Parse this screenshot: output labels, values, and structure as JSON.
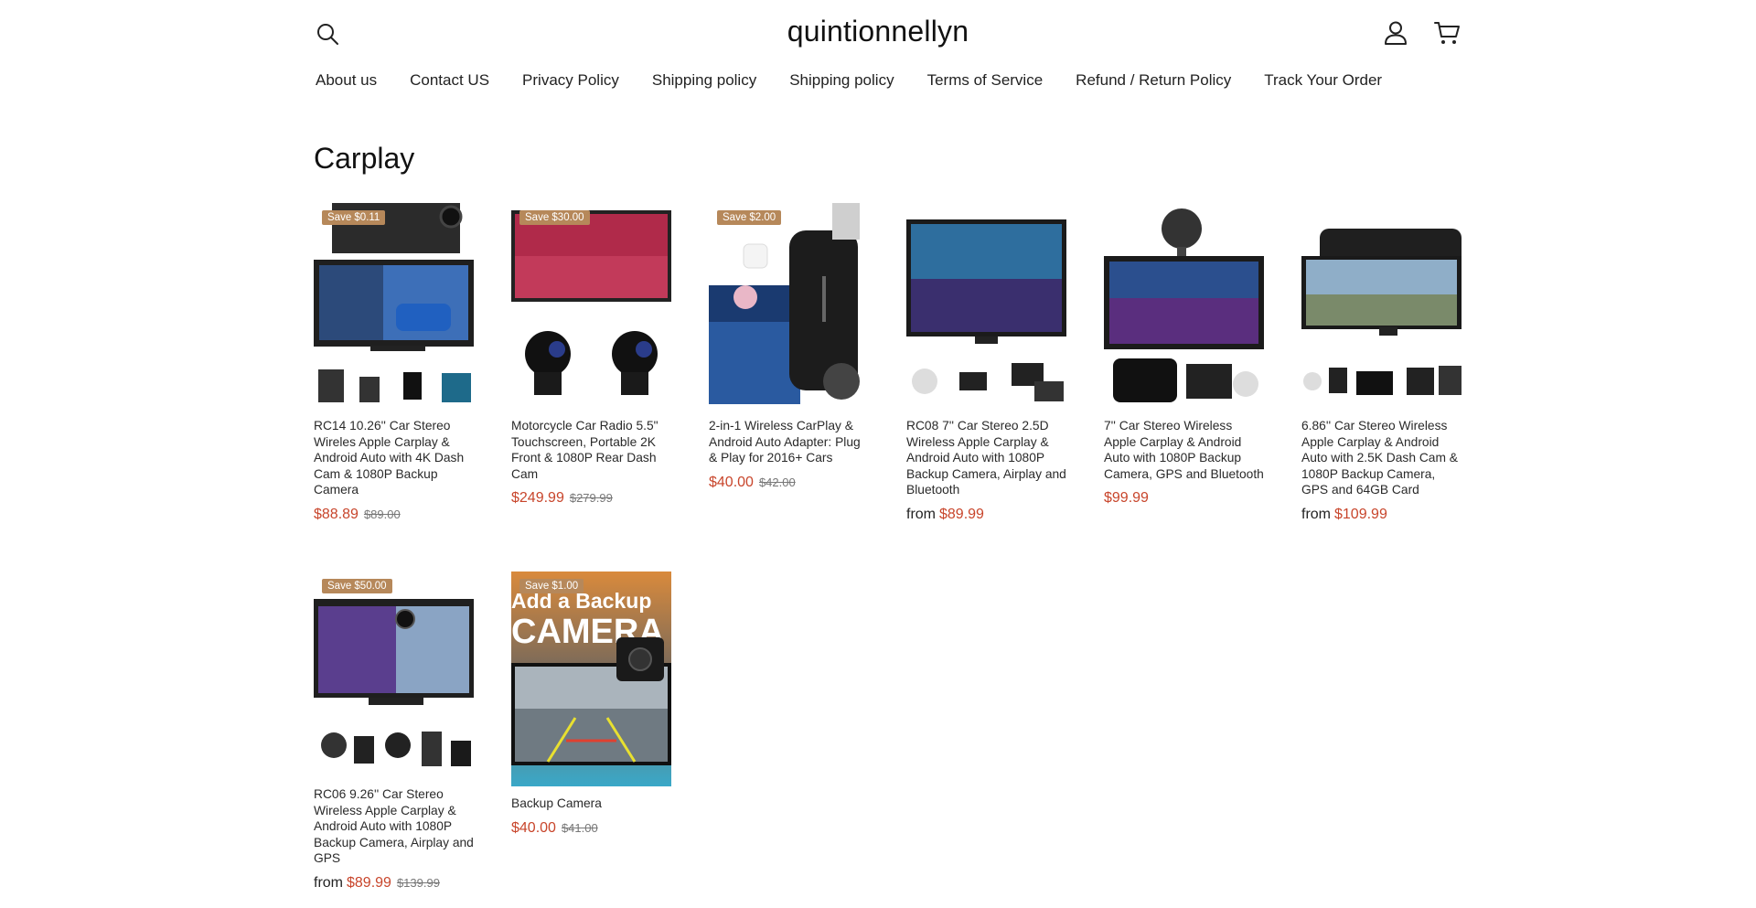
{
  "store": {
    "name": "quintionnellyn"
  },
  "header": {
    "icons": [
      "search-icon",
      "account-icon",
      "cart-icon"
    ]
  },
  "nav": {
    "items": [
      "About us",
      "Contact US",
      "Privacy Policy",
      "Shipping policy",
      "Shipping policy",
      "Terms of Service",
      "Refund / Return Policy",
      "Track Your Order"
    ]
  },
  "collection": {
    "title": "Carplay",
    "products": [
      {
        "badge": "Save $0.11",
        "title": "RC14 10.26'' Car Stereo Wireles Apple Carplay & Android Auto with 4K Dash Cam & 1080P Backup Camera",
        "from": "",
        "price": "$88.89",
        "compare": "$89.00"
      },
      {
        "badge": "Save $30.00",
        "title": "Motorcycle Car Radio 5.5\" Touchscreen, Portable 2K Front & 1080P Rear Dash Cam",
        "from": "",
        "price": "$249.99",
        "compare": "$279.99"
      },
      {
        "badge": "Save $2.00",
        "title": "2-in-1 Wireless CarPlay & Android Auto Adapter: Plug & Play for 2016+ Cars",
        "from": "",
        "price": "$40.00",
        "compare": "$42.00"
      },
      {
        "badge": "",
        "title": "RC08 7'' Car Stereo 2.5D Wireless Apple Carplay & Android Auto with 1080P Backup Camera, Airplay and Bluetooth",
        "from": "from",
        "price": "$89.99",
        "compare": ""
      },
      {
        "badge": "",
        "title": "7'' Car Stereo Wireless Apple Carplay & Android Auto with 1080P Backup Camera, GPS and Bluetooth",
        "from": "",
        "price": "$99.99",
        "compare": ""
      },
      {
        "badge": "",
        "title": "6.86'' Car Stereo Wireless Apple Carplay & Android Auto with 2.5K Dash Cam & 1080P Backup Camera, GPS and 64GB Card",
        "from": "from",
        "price": "$109.99",
        "compare": ""
      },
      {
        "badge": "Save $50.00",
        "title": "RC06 9.26'' Car Stereo Wireless Apple Carplay & Android Auto with 1080P Backup Camera, Airplay and GPS",
        "from": "from",
        "price": "$89.99",
        "compare": "$139.99"
      },
      {
        "badge": "Save $1.00",
        "title": "Backup Camera",
        "from": "",
        "price": "$40.00",
        "compare": "$41.00",
        "image_text": [
          "Add a Backup",
          "CAMERA"
        ]
      }
    ]
  },
  "colors": {
    "price": "#c8452b",
    "badge": "#b6885a",
    "text": "#1a1a1a"
  }
}
